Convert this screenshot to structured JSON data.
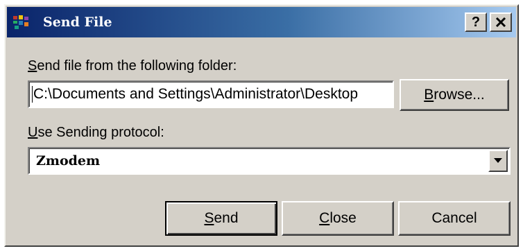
{
  "window": {
    "title": "Send File",
    "help_label": "?",
    "close_glyph": "✕",
    "icon": "app-icon"
  },
  "folder": {
    "label_prefix": "S",
    "label_rest": "end file from the following folder:",
    "value": "C:\\Documents and Settings\\Administrator\\Desktop",
    "browse_prefix": "B",
    "browse_rest": "rowse..."
  },
  "protocol": {
    "label_prefix": "U",
    "label_rest": "se Sending protocol:",
    "selected": "Zmodem",
    "arrow_icon": "chevron-down-icon"
  },
  "actions": {
    "send_prefix": "S",
    "send_rest": "end",
    "close_prefix": "C",
    "close_rest": "lose",
    "cancel_label": "Cancel"
  },
  "colors": {
    "title_bar_start": "#0a246a",
    "title_bar_end": "#a6caf0",
    "dialog_face": "#d4d0c8"
  }
}
